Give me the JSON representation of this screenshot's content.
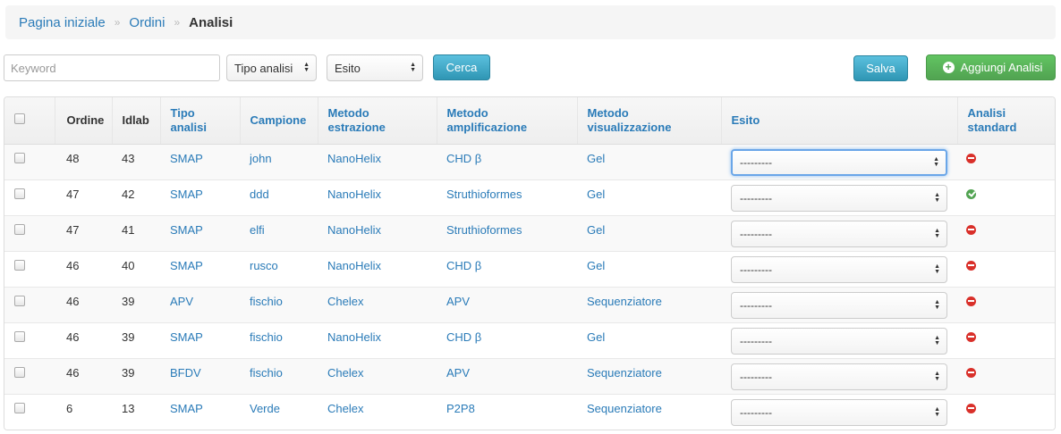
{
  "breadcrumb": {
    "home": "Pagina iniziale",
    "orders": "Ordini",
    "current": "Analisi",
    "separator": "»"
  },
  "toolbar": {
    "keyword_placeholder": "Keyword",
    "keyword_value": "",
    "tipo_analisi_selected": "Tipo analisi",
    "esito_selected": "Esito",
    "search_label": "Cerca",
    "save_label": "Salva",
    "add_label": "Aggiungi Analisi"
  },
  "table": {
    "headers": {
      "ordine": "Ordine",
      "idlab": "Idlab",
      "tipo_analisi": [
        "Tipo",
        "analisi"
      ],
      "campione": "Campione",
      "metodo_estrazione": [
        "Metodo",
        "estrazione"
      ],
      "metodo_amplificazione": [
        "Metodo",
        "amplificazione"
      ],
      "metodo_visualizzazione": [
        "Metodo",
        "visualizzazione"
      ],
      "esito": "Esito",
      "analisi_standard": [
        "Analisi",
        "standard"
      ]
    },
    "rows": [
      {
        "ordine": "48",
        "idlab": "43",
        "tipo": "SMAP",
        "campione": "john",
        "estrazione": "NanoHelix",
        "amplificazione": "CHD β",
        "visualizzazione": "Gel",
        "esito": "---------",
        "standard": "not-ok-icon"
      },
      {
        "ordine": "47",
        "idlab": "42",
        "tipo": "SMAP",
        "campione": "ddd",
        "estrazione": "NanoHelix",
        "amplificazione": "Struthioformes",
        "visualizzazione": "Gel",
        "esito": "---------",
        "standard": "ok-icon"
      },
      {
        "ordine": "47",
        "idlab": "41",
        "tipo": "SMAP",
        "campione": "elfi",
        "estrazione": "NanoHelix",
        "amplificazione": "Struthioformes",
        "visualizzazione": "Gel",
        "esito": "---------",
        "standard": "not-ok-icon"
      },
      {
        "ordine": "46",
        "idlab": "40",
        "tipo": "SMAP",
        "campione": "rusco",
        "estrazione": "NanoHelix",
        "amplificazione": "CHD β",
        "visualizzazione": "Gel",
        "esito": "---------",
        "standard": "not-ok-icon"
      },
      {
        "ordine": "46",
        "idlab": "39",
        "tipo": "APV",
        "campione": "fischio",
        "estrazione": "Chelex",
        "amplificazione": "APV",
        "visualizzazione": "Sequenziatore",
        "esito": "---------",
        "standard": "not-ok-icon"
      },
      {
        "ordine": "46",
        "idlab": "39",
        "tipo": "SMAP",
        "campione": "fischio",
        "estrazione": "NanoHelix",
        "amplificazione": "CHD β",
        "visualizzazione": "Gel",
        "esito": "---------",
        "standard": "not-ok-icon"
      },
      {
        "ordine": "46",
        "idlab": "39",
        "tipo": "BFDV",
        "campione": "fischio",
        "estrazione": "Chelex",
        "amplificazione": "APV",
        "visualizzazione": "Sequenziatore",
        "esito": "---------",
        "standard": "not-ok-icon"
      },
      {
        "ordine": "6",
        "idlab": "13",
        "tipo": "SMAP",
        "campione": "Verde",
        "estrazione": "Chelex",
        "amplificazione": "P2P8",
        "visualizzazione": "Sequenziatore",
        "esito": "---------",
        "standard": "not-ok-icon"
      }
    ]
  },
  "colors": {
    "link": "#2a7bb8",
    "info_button": "#2f96b4",
    "success_button": "#51a351",
    "status_not_ok": "#d9302a",
    "status_ok": "#51a351"
  }
}
